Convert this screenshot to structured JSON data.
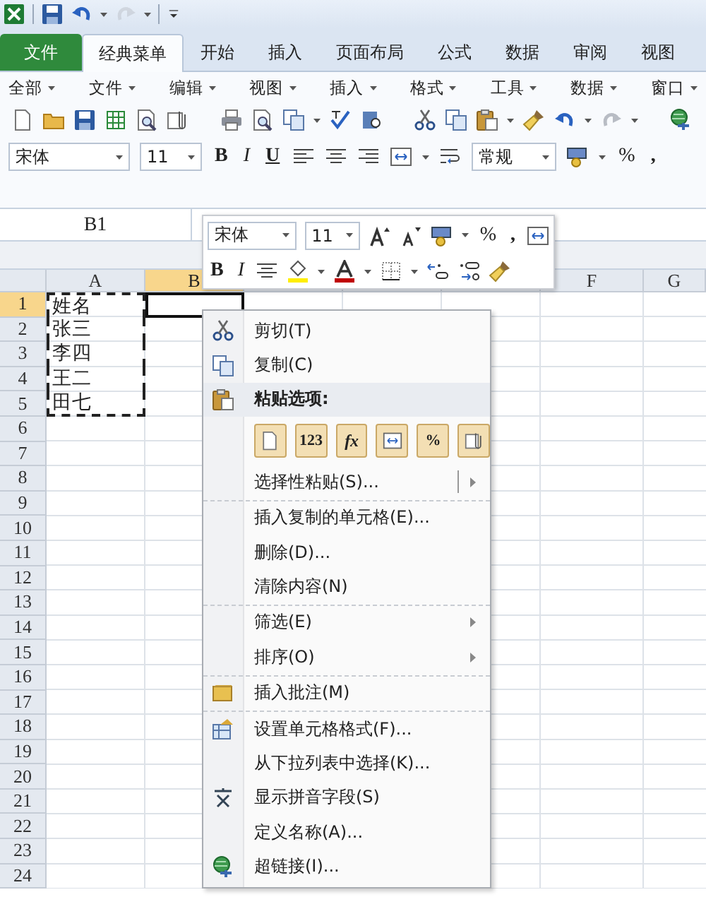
{
  "quick_access_toolbar": [
    {
      "kind": "excel",
      "disabled": false
    },
    {
      "kind": "save",
      "disabled": false
    },
    {
      "kind": "undo",
      "disabled": false
    },
    {
      "kind": "redo",
      "disabled": true
    }
  ],
  "tabs": [
    {
      "label": "文件",
      "kind": "file",
      "selected": false
    },
    {
      "label": "经典菜单",
      "kind": "tab",
      "selected": true
    },
    {
      "label": "开始",
      "kind": "tab",
      "selected": false
    },
    {
      "label": "插入",
      "kind": "tab",
      "selected": false
    },
    {
      "label": "页面布局",
      "kind": "tab",
      "selected": false
    },
    {
      "label": "公式",
      "kind": "tab",
      "selected": false
    },
    {
      "label": "数据",
      "kind": "tab",
      "selected": false
    },
    {
      "label": "审阅",
      "kind": "tab",
      "selected": false
    },
    {
      "label": "视图",
      "kind": "tab",
      "selected": false
    }
  ],
  "classic_menus": [
    "全部",
    "文件",
    "编辑",
    "视图",
    "插入",
    "格式",
    "工具",
    "数据",
    "窗口"
  ],
  "format_toolbar": {
    "font": "宋体",
    "size": "11",
    "bold": "B",
    "italic": "I",
    "underline": "U",
    "number_format": "常规",
    "percent": "%",
    "comma": ","
  },
  "name_box": "B1",
  "mini_toolbar": {
    "font": "宋体",
    "size": "11",
    "percent": "%",
    "comma": ",",
    "bold": "B",
    "italic": "I"
  },
  "sheet": {
    "columns": [
      {
        "label": "A",
        "selected": false
      },
      {
        "label": "B",
        "selected": true
      },
      {
        "label": "F",
        "selected": false
      },
      {
        "label": "G",
        "selected": false
      }
    ],
    "rows": [
      {
        "label": "1",
        "selected": true
      },
      {
        "label": "2",
        "selected": false
      },
      {
        "label": "3",
        "selected": false
      },
      {
        "label": "4",
        "selected": false
      },
      {
        "label": "5",
        "selected": false
      },
      {
        "label": "6",
        "selected": false
      },
      {
        "label": "7",
        "selected": false
      },
      {
        "label": "8",
        "selected": false
      },
      {
        "label": "9",
        "selected": false
      },
      {
        "label": "10",
        "selected": false
      },
      {
        "label": "11",
        "selected": false
      },
      {
        "label": "12",
        "selected": false
      },
      {
        "label": "13",
        "selected": false
      },
      {
        "label": "14",
        "selected": false
      },
      {
        "label": "15",
        "selected": false
      },
      {
        "label": "16",
        "selected": false
      },
      {
        "label": "17",
        "selected": false
      },
      {
        "label": "18",
        "selected": false
      },
      {
        "label": "19",
        "selected": false
      },
      {
        "label": "20",
        "selected": false
      },
      {
        "label": "21",
        "selected": false
      },
      {
        "label": "22",
        "selected": false
      },
      {
        "label": "23",
        "selected": false
      },
      {
        "label": "24",
        "selected": false
      }
    ],
    "column_a": [
      "姓名",
      "张三",
      "李四",
      "王二",
      "田七"
    ],
    "copied": true
  },
  "context_menu": [
    {
      "kind": "command",
      "label": "剪切(T)",
      "submenu": false,
      "separator_after": false
    },
    {
      "kind": "command",
      "label": "复制(C)",
      "submenu": false,
      "separator_after": false
    },
    {
      "kind": "header",
      "label": "粘贴选项:",
      "separator_after": false
    },
    {
      "kind": "paste_options",
      "options": [
        {
          "kind": "paste"
        },
        {
          "kind": "values",
          "label": "123"
        },
        {
          "kind": "formulas",
          "label": "fx"
        },
        {
          "kind": "transpose"
        },
        {
          "kind": "formatting",
          "label": "%"
        },
        {
          "kind": "link"
        }
      ]
    },
    {
      "kind": "command",
      "label": "选择性粘贴(S)...",
      "submenu": true,
      "separator_after": true
    },
    {
      "kind": "command",
      "label": "插入复制的单元格(E)...",
      "submenu": false,
      "separator_after": false
    },
    {
      "kind": "command",
      "label": "删除(D)...",
      "submenu": false,
      "separator_after": false
    },
    {
      "kind": "command",
      "label": "清除内容(N)",
      "submenu": false,
      "separator_after": true
    },
    {
      "kind": "command",
      "label": "筛选(E)",
      "submenu": true,
      "separator_after": false
    },
    {
      "kind": "command",
      "label": "排序(O)",
      "submenu": true,
      "separator_after": true
    },
    {
      "kind": "command",
      "label": "插入批注(M)",
      "submenu": false,
      "separator_after": true
    },
    {
      "kind": "command",
      "label": "设置单元格格式(F)...",
      "submenu": false,
      "separator_after": false
    },
    {
      "kind": "command",
      "label": "从下拉列表中选择(K)...",
      "submenu": false,
      "separator_after": false
    },
    {
      "kind": "command",
      "label": "显示拼音字段(S)",
      "submenu": false,
      "separator_after": false
    },
    {
      "kind": "command",
      "label": "定义名称(A)...",
      "submenu": false,
      "separator_after": false
    },
    {
      "kind": "command",
      "label": "超链接(I)...",
      "submenu": false,
      "separator_after": false
    }
  ]
}
